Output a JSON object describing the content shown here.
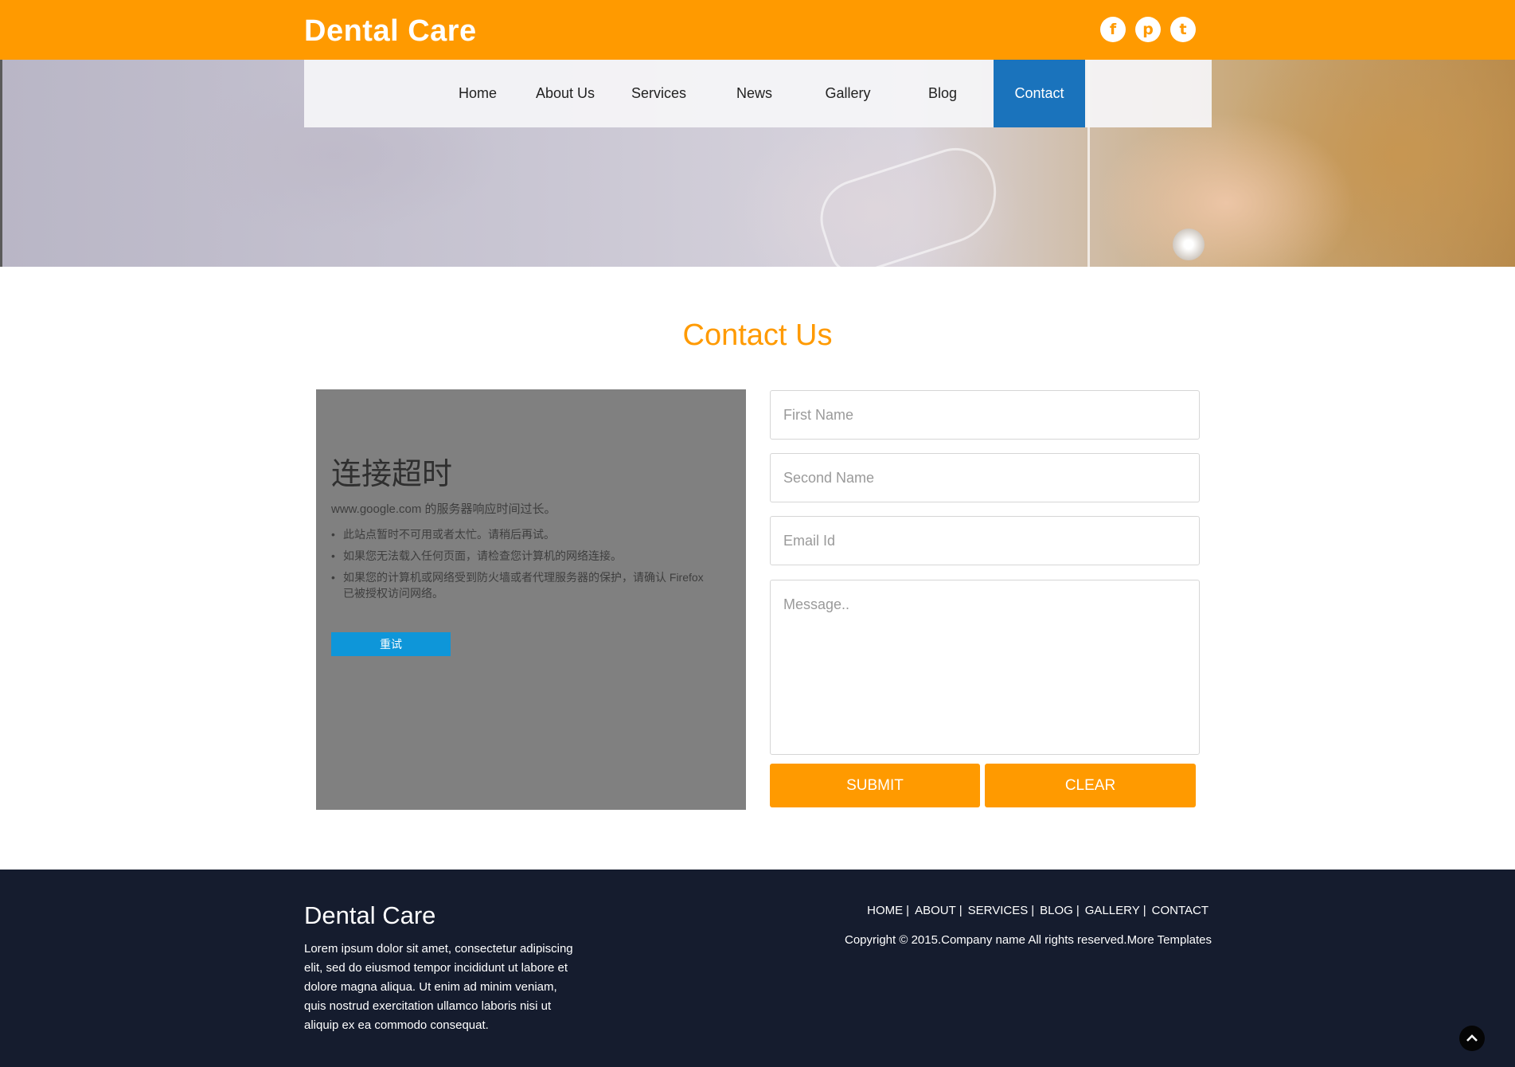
{
  "header": {
    "brand": "Dental Care",
    "social": [
      {
        "icon": "facebook-icon",
        "glyph": "f"
      },
      {
        "icon": "pinterest-icon",
        "glyph": "p"
      },
      {
        "icon": "twitter-icon",
        "glyph": "t"
      }
    ]
  },
  "nav": {
    "items": [
      {
        "label": "Home",
        "active": false
      },
      {
        "label": "About Us",
        "active": false
      },
      {
        "label": "Services",
        "active": false
      },
      {
        "label": "News",
        "active": false
      },
      {
        "label": "Gallery",
        "active": false
      },
      {
        "label": "Blog",
        "active": false
      },
      {
        "label": "Contact",
        "active": true
      }
    ]
  },
  "contact": {
    "title": "Contact Us",
    "map_error": {
      "title": "连接超时",
      "description": "www.google.com 的服务器响应时间过长。",
      "bullets": [
        "此站点暂时不可用或者太忙。请稍后再试。",
        "如果您无法载入任何页面，请检查您计算机的网络连接。",
        "如果您的计算机或网络受到防火墙或者代理服务器的保护，请确认 Firefox 已被授权访问网络。"
      ],
      "retry_label": "重试"
    },
    "form": {
      "first_name_placeholder": "First Name",
      "second_name_placeholder": "Second Name",
      "email_placeholder": "Email Id",
      "message_placeholder": "Message..",
      "submit_label": "SUBMIT",
      "clear_label": "CLEAR"
    }
  },
  "footer": {
    "brand": "Dental Care",
    "description": "Lorem ipsum dolor sit amet, consectetur adipiscing elit, sed do eiusmod tempor incididunt ut labore et dolore magna aliqua. Ut enim ad minim veniam, quis nostrud exercitation ullamco laboris nisi ut aliquip ex ea commodo consequat.",
    "links": [
      "HOME",
      "ABOUT",
      "SERVICES",
      "BLOG",
      "GALLERY",
      "CONTACT"
    ],
    "separator": "|",
    "copyright": "Copyright © 2015.Company name All rights reserved.",
    "more_templates": "More Templates",
    "to_top_icon": "arrow-up-icon"
  },
  "colors": {
    "brand_orange": "#ff9a00",
    "nav_active": "#1a73bc",
    "footer_bg": "#151c2e",
    "retry_blue": "#0e96d9",
    "map_gray": "#808080"
  }
}
